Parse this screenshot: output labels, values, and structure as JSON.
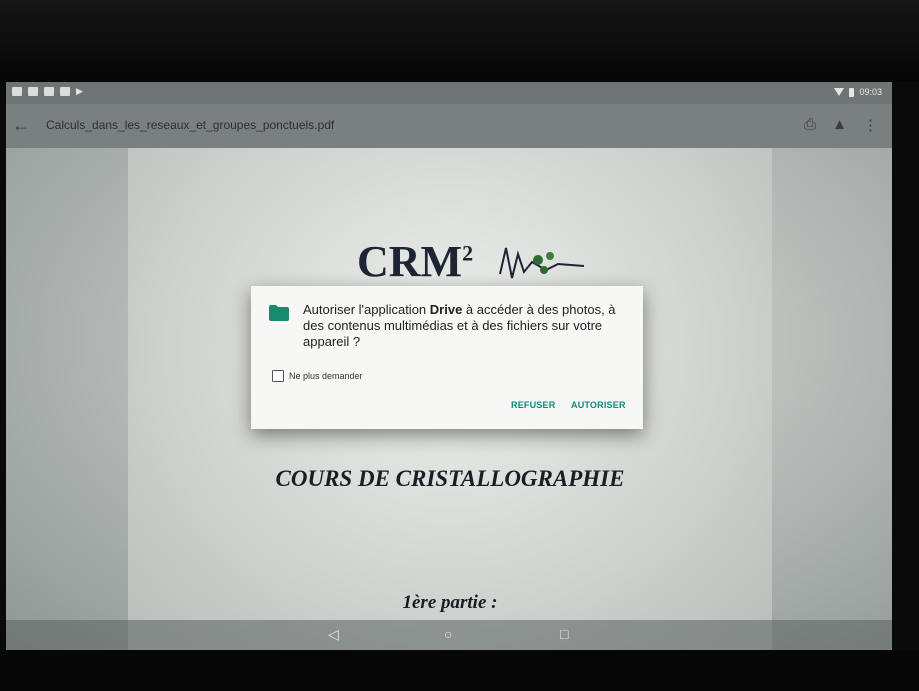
{
  "status_bar": {
    "time": "09:03",
    "left_icons": [
      "notification-icon",
      "photo-icon",
      "image-icon",
      "sim-icon",
      "play-store-icon"
    ],
    "right_icons": [
      "wifi-icon",
      "battery-icon"
    ]
  },
  "app_bar": {
    "back_icon": "arrow-left-icon",
    "title": "Calculs_dans_les_reseaux_et_groupes_ponctuels.pdf",
    "actions": [
      "print-icon",
      "drive-icon",
      "more-vert-icon"
    ]
  },
  "document": {
    "logo_text": "CRM",
    "logo_sup": "2",
    "course_title": "COURS DE CRISTALLOGRAPHIE",
    "part_title": "1ère partie :"
  },
  "dialog": {
    "message_prefix": "Autoriser l'application ",
    "app_name": "Drive",
    "message_suffix": " à accéder à des photos, à des contenus multimédias et à des fichiers sur votre appareil ?",
    "checkbox_label": "Ne plus demander",
    "checkbox_checked": false,
    "deny_label": "REFUSER",
    "allow_label": "AUTORISER",
    "accent_color": "#0b8a7c",
    "icon": "folder-icon"
  },
  "nav_bar": {
    "back": "◁",
    "home": "○",
    "recents": "□"
  }
}
